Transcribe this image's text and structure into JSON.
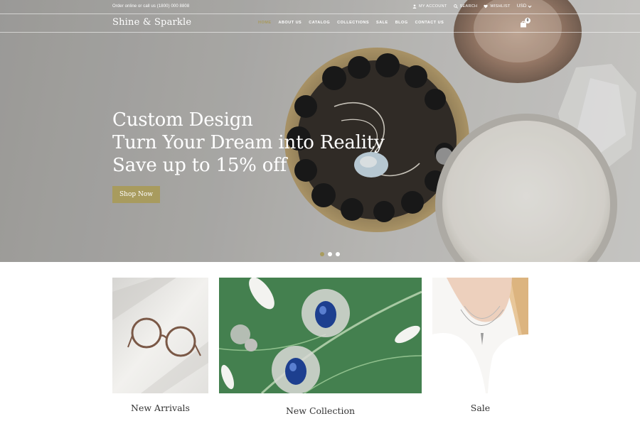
{
  "topbar": {
    "order_text": "Order online or call us (1800) 000 8808",
    "links": [
      {
        "label": "My account",
        "icon": "user-icon"
      },
      {
        "label": "Search",
        "icon": "search-icon"
      },
      {
        "label": "Wishlist",
        "icon": "heart-icon"
      }
    ],
    "currency": "USD"
  },
  "header": {
    "logo": "Shine & Sparkle",
    "menu": [
      "HOME",
      "ABOUT US",
      "CATALOG",
      "COLLECTIONS",
      "SALE",
      "BLOG",
      "CONTACT US"
    ],
    "active_menu": "HOME",
    "cart_count": "0"
  },
  "hero": {
    "lines": [
      "Custom Design",
      "Turn Your Dream into Reality",
      "Save up to 15% off"
    ],
    "button": "Shop Now",
    "slide_count": 3,
    "active_slide": 1
  },
  "categories": [
    {
      "label": "New Arrivals"
    },
    {
      "label": "New Collection"
    },
    {
      "label": "Sale"
    }
  ],
  "colors": {
    "accent": "#a89b5e",
    "active_menu": "#a99a5c",
    "text_light": "#ffffff",
    "text_dark": "#333333"
  }
}
